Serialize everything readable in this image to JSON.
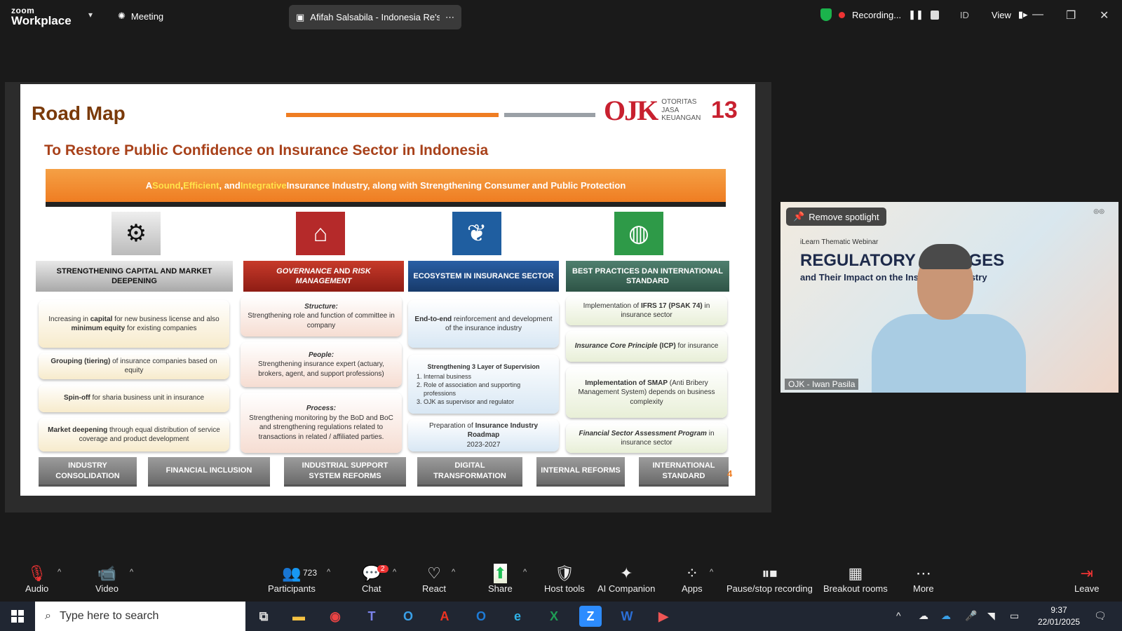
{
  "app": {
    "logo_line1": "zoom",
    "logo_line2": "Workplace",
    "meeting_label": "Meeting",
    "share_title": "Afifah Salsabila - Indonesia Re's",
    "recording_label": "Recording...",
    "lang": "ID",
    "view_label": "View"
  },
  "slide": {
    "title": "Road Map",
    "ojk_mark": "OJK",
    "ojk_text1": "OTORITAS",
    "ojk_text2": "JASA",
    "ojk_text3": "KEUANGAN",
    "anniv": "13",
    "subtitle": "To Restore Public Confidence on Insurance Sector in Indonesia",
    "banner_a": "A ",
    "banner_sound": "Sound",
    "banner_comma1": ", ",
    "banner_efficient": "Efficient",
    "banner_and": ", and ",
    "banner_integrative": "Integrative",
    "banner_rest": " Insurance Industry, along with Strengthening Consumer and Public Protection",
    "pillars": [
      {
        "head": "STRENGTHENING CAPITAL AND MARKET DEEPENING"
      },
      {
        "head_i1": "GOVERNANCE",
        "head_mid": " AND ",
        "head_i2": "RISK MANAGEMENT"
      },
      {
        "head": "ECOSYSTEM IN INSURANCE SECTOR"
      },
      {
        "head": "BEST PRACTICES DAN INTERNATIONAL STANDARD"
      }
    ],
    "c1": {
      "a1": "Increasing in ",
      "a2": "capital",
      "a3": " for new business license and also ",
      "a4": "minimum equity",
      "a5": " for existing companies",
      "b1": "Grouping (tiering)",
      "b2": " of insurance companies based on equity",
      "d1": "Spin-off",
      "d2": " for sharia business unit in insurance",
      "e1": "Market deepening",
      "e2": " through equal distribution of service coverage and product development"
    },
    "c2": {
      "s_t": "Structure:",
      "s_d": "Strengthening role and function of committee in company",
      "p_t": "People:",
      "p_d": "Strengthening insurance expert (actuary, brokers, agent, and support professions)",
      "r_t": "Process:",
      "r_d": "Strengthening monitoring by the BoD and BoC and strengthening regulations related to transactions in related / affiliated parties."
    },
    "c3": {
      "a1": "End-to-end",
      "a2": " reinforcement and development of the insurance industry",
      "b_t": "Strengthening 3 Layer of Supervision",
      "b_items": [
        "Internal business",
        "Role of association and supporting professions",
        "OJK as supervisor and regulator"
      ],
      "d1": "Preparation of ",
      "d2": "Insurance Industry Roadmap",
      "d3": "2023-2027"
    },
    "c4": {
      "a1": "Implementation of ",
      "a2": "IFRS 17 (PSAK 74)",
      "a3": " in insurance sector",
      "b1": "Insurance Core Principle",
      "b2": " (ICP)",
      "b3": " for insurance",
      "d1": "Implementation of SMAP",
      "d2": " (Anti Bribery Management System) depends on business complexity",
      "e1": "Financial Sector Assessment Program",
      "e2": " in insurance sector"
    },
    "footer": [
      "INDUSTRY CONSOLIDATION",
      "FINANCIAL INCLUSION",
      "INDUSTRIAL SUPPORT SYSTEM REFORMS",
      "DIGITAL TRANSFORMATION",
      "INTERNAL REFORMS",
      "INTERNATIONAL STANDARD"
    ],
    "page_number": "4"
  },
  "video": {
    "remove_spotlight": "Remove spotlight",
    "small_title": "iLearn Thematic Webinar",
    "big_title": "REGULATORY CHANGES",
    "sub_title": "and Their Impact on the Insurance Industry",
    "name": "OJK - Iwan Pasila"
  },
  "toolbar": {
    "audio": "Audio",
    "video": "Video",
    "participants": "Participants",
    "participants_count": "723",
    "chat": "Chat",
    "chat_badge": "2",
    "react": "React",
    "share": "Share",
    "host_tools": "Host tools",
    "ai_companion": "AI Companion",
    "apps": "Apps",
    "pause_rec": "Pause/stop recording",
    "breakout": "Breakout rooms",
    "more": "More",
    "leave": "Leave"
  },
  "taskbar": {
    "search_placeholder": "Type here to search",
    "time": "9:37",
    "date": "22/01/2025"
  },
  "colors": {
    "accent_orange": "#ef7d22",
    "ojk_red": "#c8202f",
    "pillar1": "#8c8c8c",
    "pillar2": "#b52a2a",
    "pillar3": "#1f4e8c",
    "pillar4": "#3f6b5a"
  }
}
